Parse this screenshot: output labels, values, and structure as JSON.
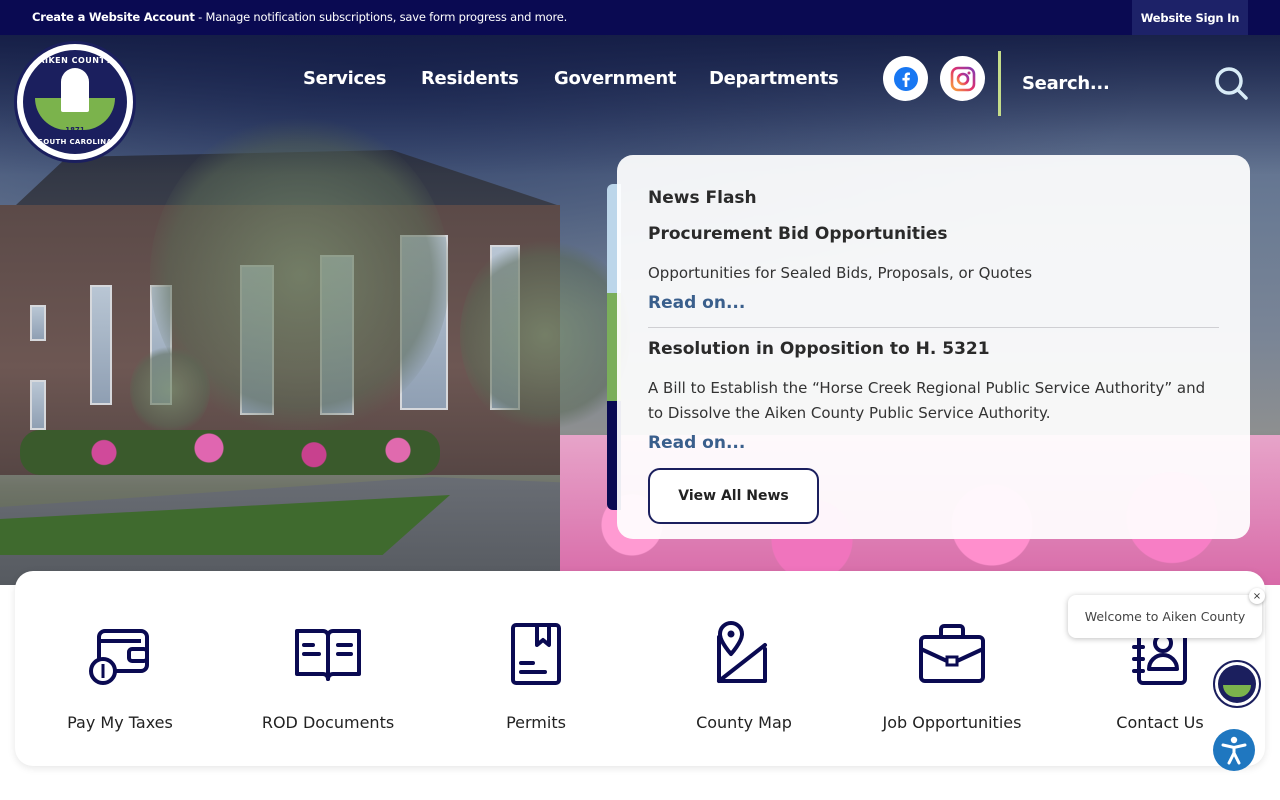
{
  "topbar": {
    "account_bold": "Create a Website Account",
    "account_rest": " - Manage notification subscriptions, save form progress and more.",
    "signin": "Website Sign In"
  },
  "logo": {
    "top_text": "AIKEN COUNTY",
    "bottom_text": "SOUTH CAROLINA",
    "year": "1871"
  },
  "nav": {
    "items": [
      "Services",
      "Residents",
      "Government",
      "Departments"
    ]
  },
  "social": {
    "facebook_icon": "facebook-icon",
    "instagram_icon": "instagram-icon"
  },
  "search": {
    "placeholder": "Search..."
  },
  "news": {
    "label": "News Flash",
    "items": [
      {
        "title": "Procurement Bid Opportunities",
        "desc": "Opportunities for Sealed Bids, Proposals, or Quotes",
        "read_on": "Read on..."
      },
      {
        "title": "Resolution in Opposition to H. 5321",
        "desc": "A Bill to Establish the “Horse Creek Regional Public Service Authority” and to Dissolve the Aiken County Public Service Authority.",
        "read_on": "Read on..."
      }
    ],
    "view_all": "View All News",
    "bar_colors": [
      "#bcd6ea",
      "#7aae5a",
      "#0a0a52"
    ]
  },
  "quick_links": [
    {
      "label": "Pay My Taxes",
      "icon": "wallet-coin-icon"
    },
    {
      "label": "ROD Documents",
      "icon": "open-book-icon"
    },
    {
      "label": "Permits",
      "icon": "permit-document-icon"
    },
    {
      "label": "County Map",
      "icon": "map-pin-icon"
    },
    {
      "label": "Job Opportunities",
      "icon": "briefcase-icon"
    },
    {
      "label": "Contact Us",
      "icon": "contact-book-icon"
    }
  ],
  "chat": {
    "message": "Welcome to Aiken County",
    "close": "×"
  },
  "colors": {
    "navy": "#0a0a52",
    "accent_green": "#c5dd8a",
    "link_blue": "#3a5f8c"
  }
}
